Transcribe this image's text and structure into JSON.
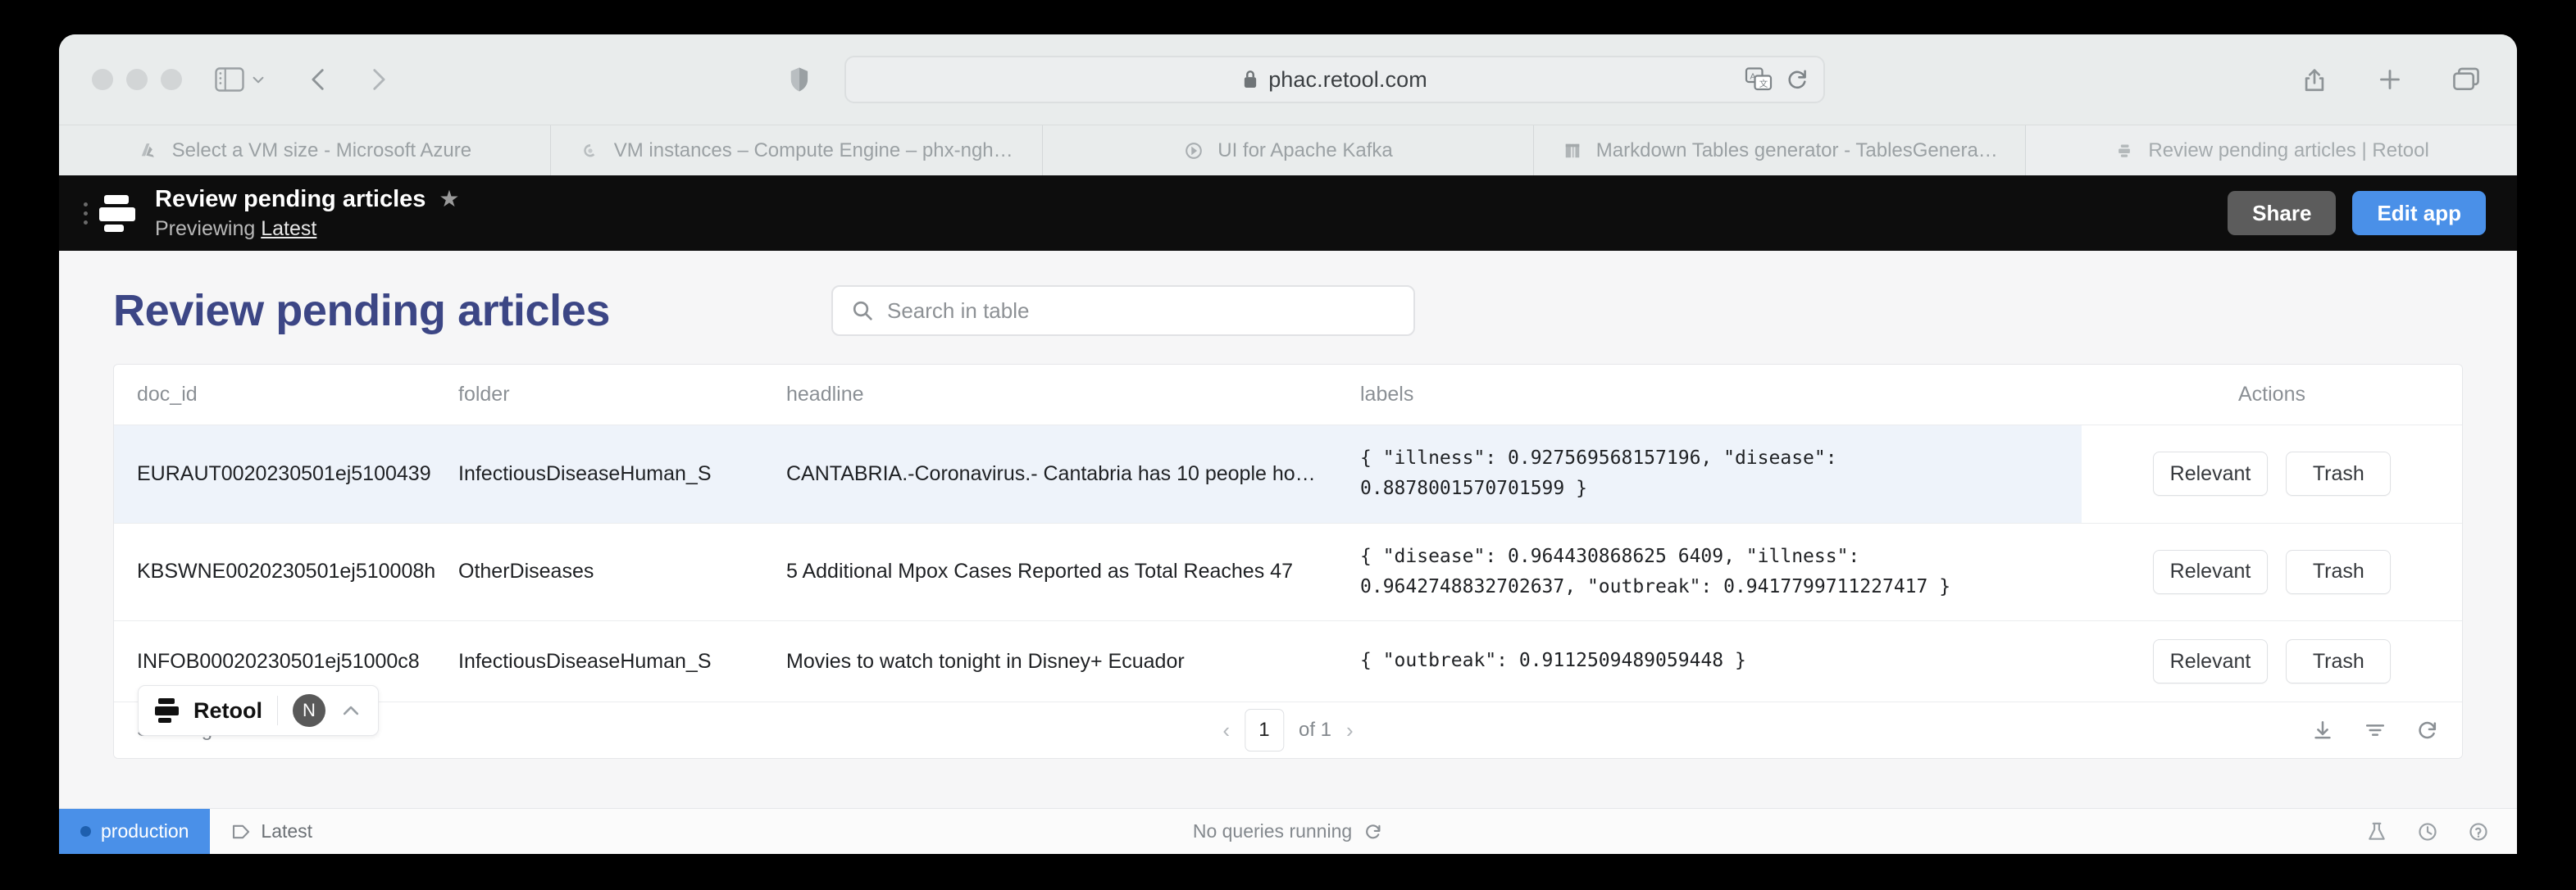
{
  "browser": {
    "url": "phac.retool.com",
    "lock_icon": "lock-icon",
    "tabs": [
      {
        "title": "Select a VM size - Microsoft Azure",
        "favicon": "azure-icon",
        "active": false
      },
      {
        "title": "VM instances – Compute Engine – phx-ngh…",
        "favicon": "google-cloud-icon",
        "active": false
      },
      {
        "title": "UI for Apache Kafka",
        "favicon": "kafka-icon",
        "active": false
      },
      {
        "title": "Markdown Tables generator - TablesGenera…",
        "favicon": "tables-icon",
        "active": false
      },
      {
        "title": "Review pending articles | Retool",
        "favicon": "retool-icon",
        "active": true
      }
    ]
  },
  "app_header": {
    "title": "Review pending articles",
    "star_icon": "star-icon",
    "previewing_label": "Previewing",
    "previewing_value": "Latest",
    "share_label": "Share",
    "edit_label": "Edit app",
    "edit_color": "#4a90e8"
  },
  "page": {
    "title": "Review pending articles",
    "title_color": "#3c4685"
  },
  "search": {
    "placeholder": "Search in table",
    "value": "",
    "icon": "search-icon"
  },
  "table": {
    "columns": [
      "doc_id",
      "folder",
      "headline",
      "labels",
      "Actions"
    ],
    "rows": [
      {
        "doc_id": "EURAUT0020230501ej5100439",
        "folder": "InfectiousDiseaseHuman_S",
        "headline": "CANTABRIA.-Coronavirus.- Cantabria has 10 people ho…",
        "labels": "{ \"illness\": 0.927569568157196, \"disease\": 0.8878001570701599 }",
        "highlighted": true,
        "relevant_label": "Relevant",
        "trash_label": "Trash"
      },
      {
        "doc_id": "KBSWNE0020230501ej510008h",
        "folder": "OtherDiseases",
        "headline": "5 Additional Mpox Cases Reported as Total Reaches 47",
        "labels": "{ \"disease\": 0.964430868625 6409, \"illness\": 0.9642748832702637, \"outbreak\": 0.9417799711227417 }",
        "highlighted": false,
        "relevant_label": "Relevant",
        "trash_label": "Trash"
      },
      {
        "doc_id": "INFOB00020230501ej51000c8",
        "folder": "InfectiousDiseaseHuman_S",
        "headline": "Movies to watch tonight in Disney+ Ecuador",
        "labels": "{ \"outbreak\": 0.9112509489059448 }",
        "highlighted": false,
        "relevant_label": "Relevant",
        "trash_label": "Trash"
      }
    ],
    "footer": {
      "showing": "Showing 1-3 of 3",
      "page_value": "1",
      "of_label": "of 1",
      "prev_icon": "chevron-left-icon",
      "next_icon": "chevron-right-icon",
      "download_icon": "download-icon",
      "filter_icon": "filter-icon",
      "refresh_icon": "refresh-icon"
    }
  },
  "retool_pill": {
    "name": "Retool",
    "avatar_initial": "N",
    "chevron_icon": "chevron-up-icon"
  },
  "status_bar": {
    "environment": "production",
    "env_color": "#4a90e8",
    "branch": "Latest",
    "branch_icon": "branch-tag-icon",
    "queries": "No queries running",
    "queries_icon": "refresh-icon",
    "right_icons": [
      "beaker-icon",
      "history-icon",
      "help-icon"
    ]
  }
}
